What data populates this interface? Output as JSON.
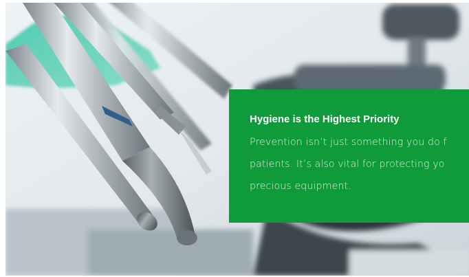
{
  "hero": {
    "image_icon": "dental-handpieces-photo"
  },
  "panel": {
    "heading": "Hygiene is the Highest Priority",
    "body_lines": [
      "Prevention isn’t just something you do f",
      "patients. It’s also vital for protecting yo",
      "precious equipment."
    ]
  },
  "colors": {
    "panel_green": "#0f9a3c",
    "heading_text": "#ffffff",
    "body_text": "#d9f1df"
  }
}
